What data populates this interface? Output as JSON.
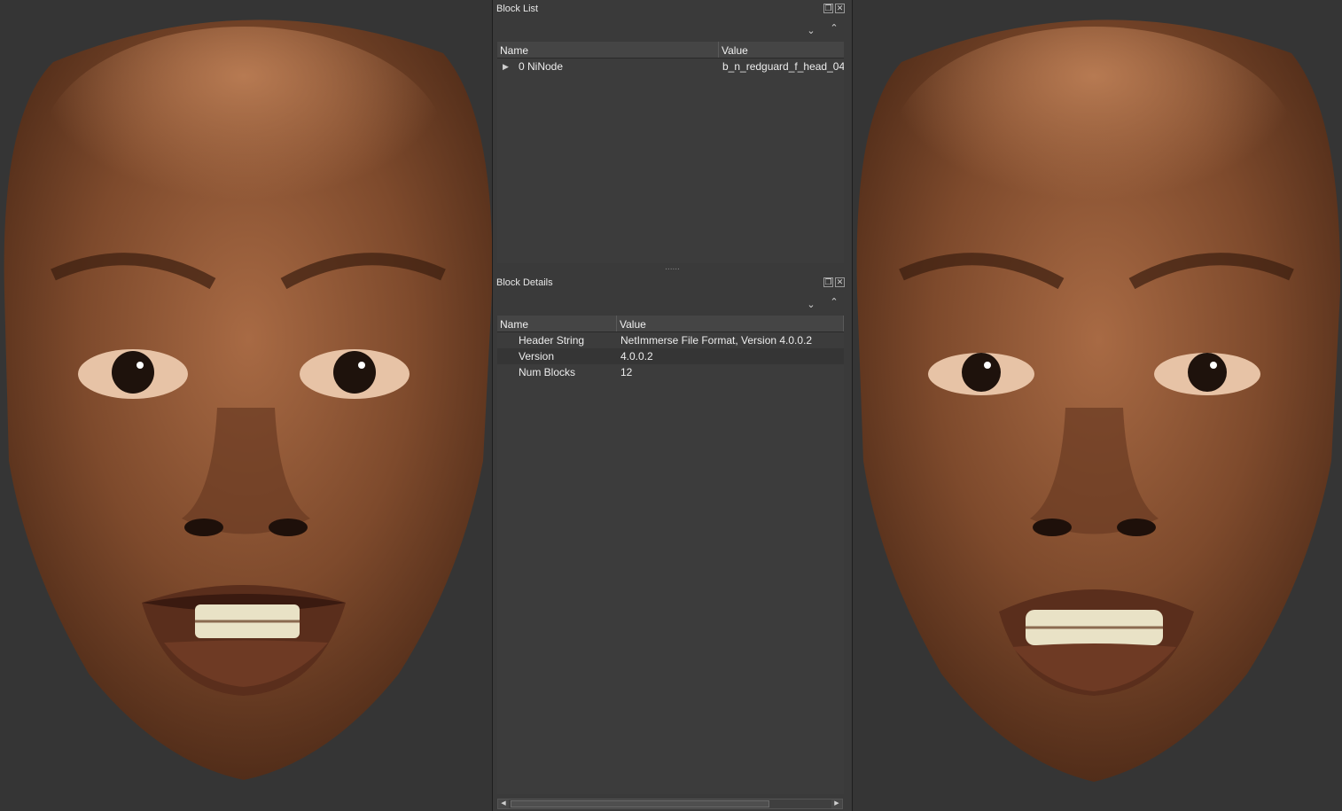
{
  "block_list": {
    "title": "Block List",
    "columns": [
      "Name",
      "Value"
    ],
    "rows": [
      {
        "name": "0 NiNode",
        "value": "b_n_redguard_f_head_04"
      }
    ]
  },
  "block_details": {
    "title": "Block Details",
    "columns": [
      "Name",
      "Value"
    ],
    "rows": [
      {
        "name": "Header String",
        "value": "NetImmerse File Format, Version 4.0.0.2"
      },
      {
        "name": "Version",
        "value": "4.0.0.2"
      },
      {
        "name": "Num Blocks",
        "value": "12"
      }
    ]
  },
  "icons": {
    "float": "float-icon",
    "close": "close-icon",
    "collapse": "collapse-all-icon",
    "expand": "expand-all-icon",
    "expander": "triangle-right-icon",
    "scroll_left": "arrow-left-icon",
    "scroll_right": "arrow-right-icon"
  },
  "colors": {
    "panel_bg": "#3a3a3a",
    "viewport_bg": "#353535",
    "skin": "#8a5535"
  }
}
